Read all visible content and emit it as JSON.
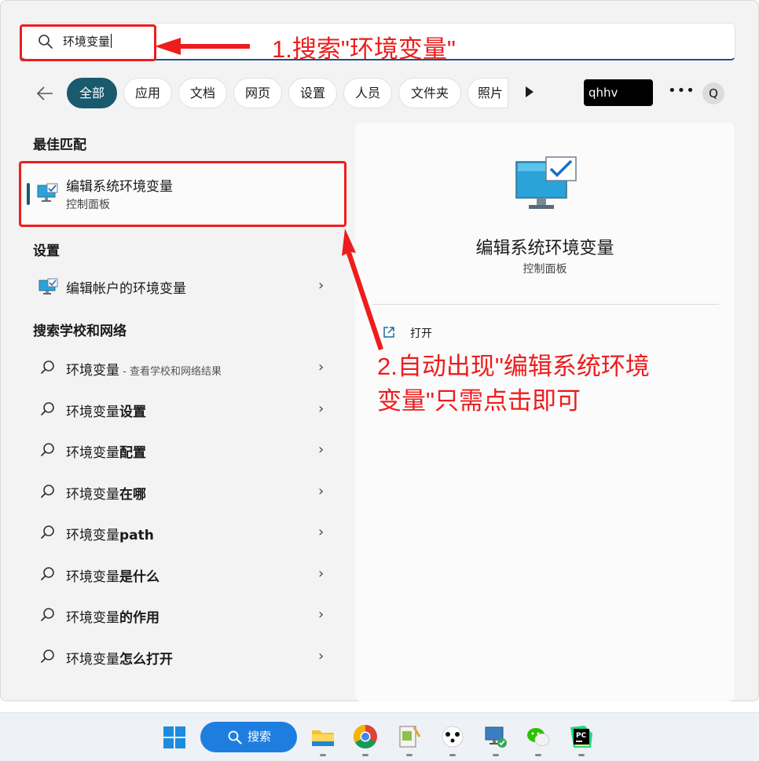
{
  "search": {
    "query": "环境变量"
  },
  "filters": [
    "全部",
    "应用",
    "文档",
    "网页",
    "设置",
    "人员",
    "文件夹",
    "照片"
  ],
  "account": {
    "name": "qhhv"
  },
  "avatar_letter": "Q",
  "sections": {
    "best_match": "最佳匹配",
    "settings": "设置",
    "school_web": "搜索学校和网络"
  },
  "best_match": {
    "title": "编辑系统环境变量",
    "subtitle": "控制面板"
  },
  "settings_items": [
    {
      "label": "编辑帐户的环境变量"
    }
  ],
  "web_results": [
    {
      "prefix": "环境变量",
      "bold": "",
      "hint": " - 查看学校和网络结果"
    },
    {
      "prefix": "环境变量",
      "bold": "设置",
      "hint": ""
    },
    {
      "prefix": "环境变量",
      "bold": "配置",
      "hint": ""
    },
    {
      "prefix": "环境变量",
      "bold": "在哪",
      "hint": ""
    },
    {
      "prefix": "环境变量",
      "bold": "path",
      "hint": ""
    },
    {
      "prefix": "环境变量",
      "bold": "是什么",
      "hint": ""
    },
    {
      "prefix": "环境变量",
      "bold": "的作用",
      "hint": ""
    },
    {
      "prefix": "环境变量",
      "bold": "怎么打开",
      "hint": ""
    }
  ],
  "preview": {
    "title": "编辑系统环境变量",
    "subtitle": "控制面板",
    "open_label": "打开"
  },
  "annotations": {
    "step1": "1.搜索\"环境变量\"",
    "step2_line1": "2.自动出现\"编辑系统环境",
    "step2_line2": "变量\"只需点击即可"
  },
  "taskbar": {
    "search_label": "搜索"
  },
  "colors": {
    "accent": "#1a5a6e",
    "annotation": "#ee1d1d",
    "taskbar_search": "#1e7ee0"
  }
}
